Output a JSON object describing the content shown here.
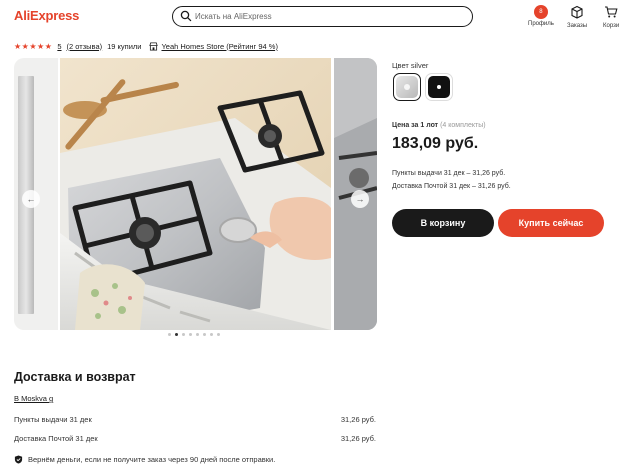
{
  "header": {
    "logo": "AliExpress",
    "search_placeholder": "Искать на AliExpress",
    "profile_label": "Профиль",
    "profile_badge": "8",
    "orders_label": "Заказы",
    "cart_label": "Корзи"
  },
  "rating": {
    "stars": "★★★★★",
    "score": "5",
    "reviews": "(2 отзыва)",
    "sold": "19 купили",
    "store": "Yeah Homes Store (Рейтинг 94 %)"
  },
  "gallery": {
    "dots_total": 8,
    "dots_active": 2
  },
  "product": {
    "color_label": "Цвет silver",
    "price_label": "Цена за 1 лот",
    "price_sub": "(4 комплекты)",
    "price": "183,09 руб.",
    "delivery_pickup": "Пункты выдачи 31 дек – 31,26 руб.",
    "delivery_post": "Доставка Почтой 31 дек – 31,26 руб.",
    "cart_button": "В корзину",
    "buy_button": "Купить сейчас"
  },
  "delivery": {
    "title": "Доставка и возврат",
    "city": "В Moskva g",
    "rows": [
      {
        "label": "Пункты выдачи 31 дек",
        "value": "31,26 руб."
      },
      {
        "label": "Доставка Почтой 31 дек",
        "value": "31,26 руб."
      }
    ],
    "guarantee": "Вернём деньги, если не получите заказ через 90 дней после отправки."
  },
  "colors": {
    "brand": "#e5432b",
    "dark": "#1a1a1a"
  }
}
